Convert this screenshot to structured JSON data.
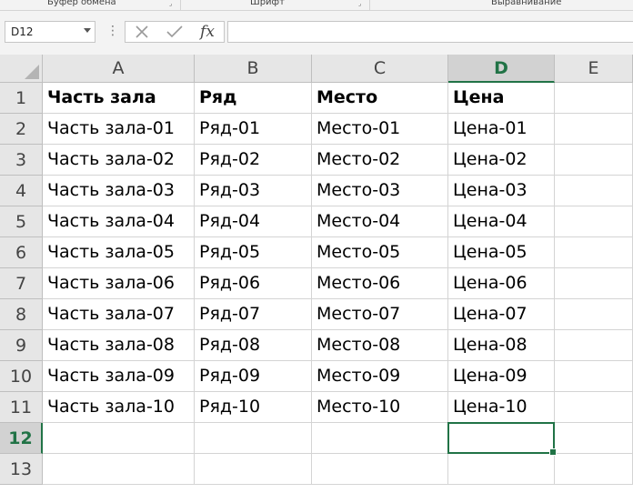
{
  "ribbon": {
    "groups": [
      {
        "label": "Буфер обмена",
        "left": 0
      },
      {
        "label": "Шрифт"
      },
      {
        "label": "Выравнивание"
      }
    ]
  },
  "formula_bar": {
    "name_box": "D12",
    "formula_value": "",
    "fx_label": "fx"
  },
  "sheet": {
    "columns": [
      "A",
      "B",
      "C",
      "D",
      "E"
    ],
    "active_column": "D",
    "active_row": "12",
    "rows": [
      {
        "num": "1",
        "cells": [
          "Часть зала",
          "Ряд",
          "Место",
          "Цена",
          ""
        ]
      },
      {
        "num": "2",
        "cells": [
          "Часть зала-01",
          "Ряд-01",
          "Место-01",
          "Цена-01",
          ""
        ]
      },
      {
        "num": "3",
        "cells": [
          "Часть зала-02",
          "Ряд-02",
          "Место-02",
          "Цена-02",
          ""
        ]
      },
      {
        "num": "4",
        "cells": [
          "Часть зала-03",
          "Ряд-03",
          "Место-03",
          "Цена-03",
          ""
        ]
      },
      {
        "num": "5",
        "cells": [
          "Часть зала-04",
          "Ряд-04",
          "Место-04",
          "Цена-04",
          ""
        ]
      },
      {
        "num": "6",
        "cells": [
          "Часть зала-05",
          "Ряд-05",
          "Место-05",
          "Цена-05",
          ""
        ]
      },
      {
        "num": "7",
        "cells": [
          "Часть зала-06",
          "Ряд-06",
          "Место-06",
          "Цена-06",
          ""
        ]
      },
      {
        "num": "8",
        "cells": [
          "Часть зала-07",
          "Ряд-07",
          "Место-07",
          "Цена-07",
          ""
        ]
      },
      {
        "num": "9",
        "cells": [
          "Часть зала-08",
          "Ряд-08",
          "Место-08",
          "Цена-08",
          ""
        ]
      },
      {
        "num": "10",
        "cells": [
          "Часть зала-09",
          "Ряд-09",
          "Место-09",
          "Цена-09",
          ""
        ]
      },
      {
        "num": "11",
        "cells": [
          "Часть зала-10",
          "Ряд-10",
          "Место-10",
          "Цена-10",
          ""
        ]
      },
      {
        "num": "12",
        "cells": [
          "",
          "",
          "",
          "",
          ""
        ]
      },
      {
        "num": "13",
        "cells": [
          "",
          "",
          "",
          "",
          ""
        ]
      }
    ]
  },
  "colors": {
    "accent": "#217346",
    "header_bg": "#e6e6e6",
    "gridline": "#d4d4d4"
  }
}
